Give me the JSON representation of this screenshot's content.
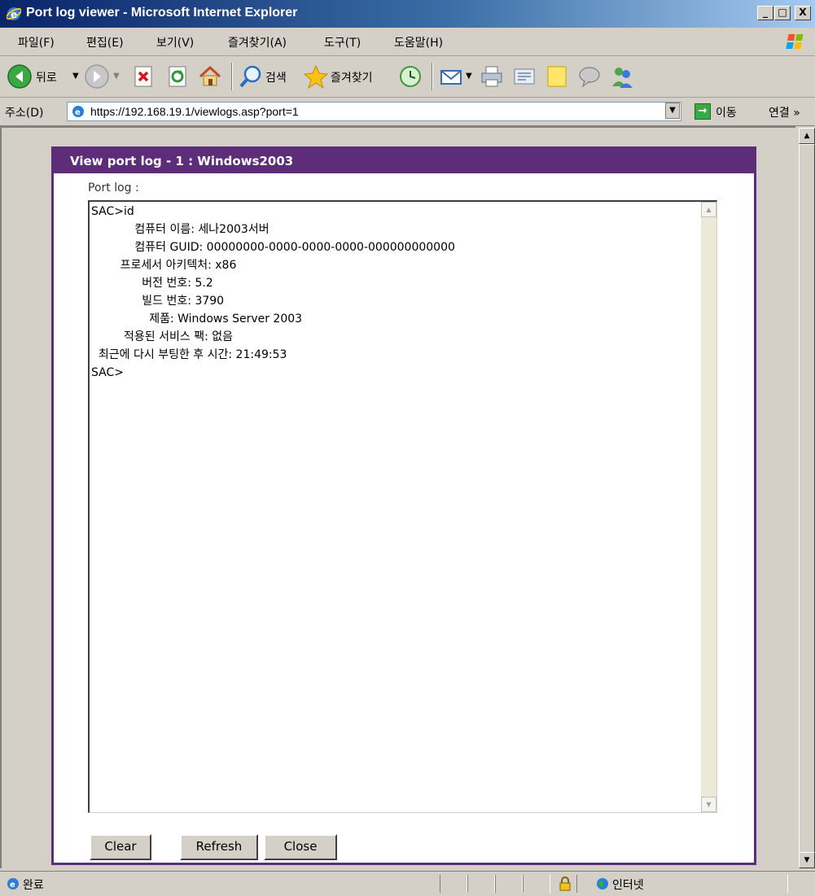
{
  "window": {
    "title": "Port log viewer - Microsoft Internet Explorer",
    "controls": [
      "_",
      "□",
      "X"
    ]
  },
  "menu": {
    "items": [
      "파일(F)",
      "편집(E)",
      "보기(V)",
      "즐겨찾기(A)",
      "도구(T)",
      "도움말(H)"
    ]
  },
  "toolbar": {
    "back_label": "뒤로",
    "search_label": "검색",
    "favorites_label": "즐겨찾기"
  },
  "address": {
    "label": "주소(D)",
    "url": "https://192.168.19.1/viewlogs.asp?port=1",
    "go_label": "이동",
    "links_label": "연결 »"
  },
  "panel": {
    "title": "View port log - 1 : Windows2003",
    "log_label": "Port log :",
    "log_lines": [
      "SAC>id",
      "            컴퓨터 이름: 세나2003서버",
      "            컴퓨터 GUID: 00000000-0000-0000-0000-000000000000",
      "        프로세서 아키텍처: x86",
      "              버전 번호: 5.2",
      "              빌드 번호: 3790",
      "                제품: Windows Server 2003",
      "         적용된 서비스 팩: 없음",
      "  최근에 다시 부팅한 후 시간: 21:49:53",
      "SAC>"
    ],
    "buttons": {
      "clear": "Clear",
      "refresh": "Refresh",
      "close": "Close"
    }
  },
  "status": {
    "text": "완료",
    "zone": "인터넷"
  },
  "colors": {
    "panel_accent": "#5e2d79",
    "titlebar": "#0a246a",
    "chrome": "#d4d0c8"
  }
}
